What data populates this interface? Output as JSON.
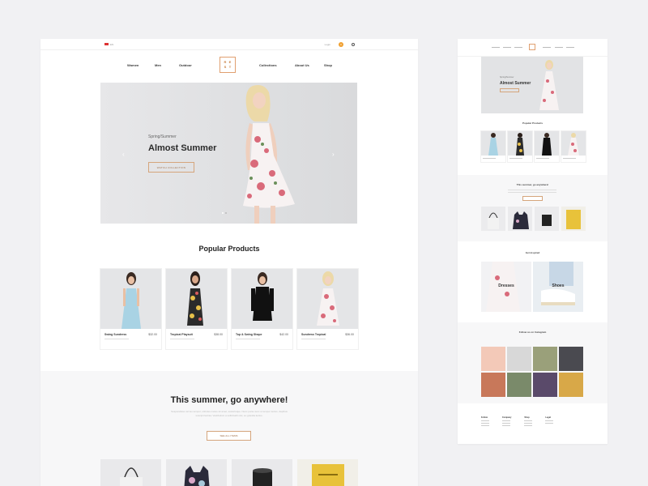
{
  "topbar": {
    "lang": "EN",
    "login": "Login",
    "cart_count": "0"
  },
  "nav": {
    "left": [
      "Women",
      "Men",
      "Outdoor"
    ],
    "logo_letters": [
      "R",
      "E",
      "S",
      "T"
    ],
    "right": [
      "Collections",
      "About Us",
      "Shop"
    ]
  },
  "hero": {
    "eyebrow": "Spring/Summer",
    "title": "Almost Summer",
    "cta": "WATCH COLLECTION",
    "arrow_left": "‹",
    "arrow_right": "›"
  },
  "popular": {
    "title": "Popular Products",
    "products": [
      {
        "name": "Swing Sundress",
        "price": "$32.00"
      },
      {
        "name": "Tropical Playsuit",
        "price": "$38.00"
      },
      {
        "name": "Top & Swing Shape",
        "price": "$42.00"
      },
      {
        "name": "Sundress Tropical",
        "price": "$36.00"
      }
    ]
  },
  "summer": {
    "title": "This summer, go anywhere!",
    "text": "Suspendisse vel leo tempor, ultricies metus sit amet, scelerisque. Nunc porta nunc ut tempor lectus, dapibus suscipit lacinia. Vestibulum a sollicitudin dui, eu gravida lectus.",
    "cta": "SEE ALL ITEMS"
  },
  "side": {
    "hero_eyebrow": "Spring/Summer",
    "hero_title": "Almost Summer",
    "popular_title": "Popular Products",
    "summer_title": "This summer, go anywhere!",
    "inspired_title": "Get inspired",
    "inspired": [
      "Dresses",
      "Shoes"
    ],
    "instagram_title": "Follow us on Instagram",
    "footer_cols": [
      "Follow",
      "Company",
      "Shop",
      "Legal"
    ]
  }
}
